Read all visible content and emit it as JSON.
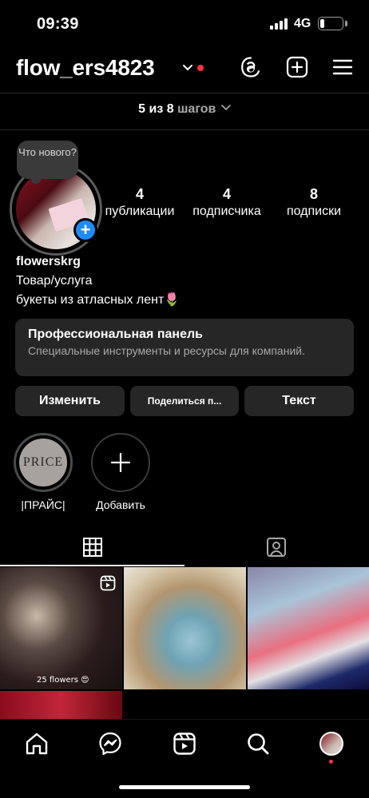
{
  "status": {
    "time": "09:39",
    "network": "4G"
  },
  "header": {
    "username": "flow_ers4823"
  },
  "steps": {
    "progress": "5 из 8",
    "label": "шагов"
  },
  "profile": {
    "note": "Что нового?",
    "posts_count": "4",
    "posts_label": "публикации",
    "followers_count": "4",
    "followers_label": "подписчика",
    "following_count": "8",
    "following_label": "подписки",
    "name": "flowerskrg",
    "category": "Товар/услуга",
    "bio": "букеты из атласных лент🌷"
  },
  "panel": {
    "title": "Профессиональная панель",
    "subtitle": "Специальные инструменты и ресурсы для компаний."
  },
  "buttons": {
    "edit": "Изменить",
    "share": "Поделиться п...",
    "text": "Текст"
  },
  "highlights": [
    {
      "cover_text": "PRICE",
      "label": "|ПРАЙС|"
    },
    {
      "label": "Добавить"
    }
  ],
  "posts": [
    {
      "caption": "25 flowers 😍"
    }
  ],
  "colors": {
    "accent_blue": "#1d8cf8",
    "notification_red": "#ff3040",
    "surface": "#262626"
  }
}
